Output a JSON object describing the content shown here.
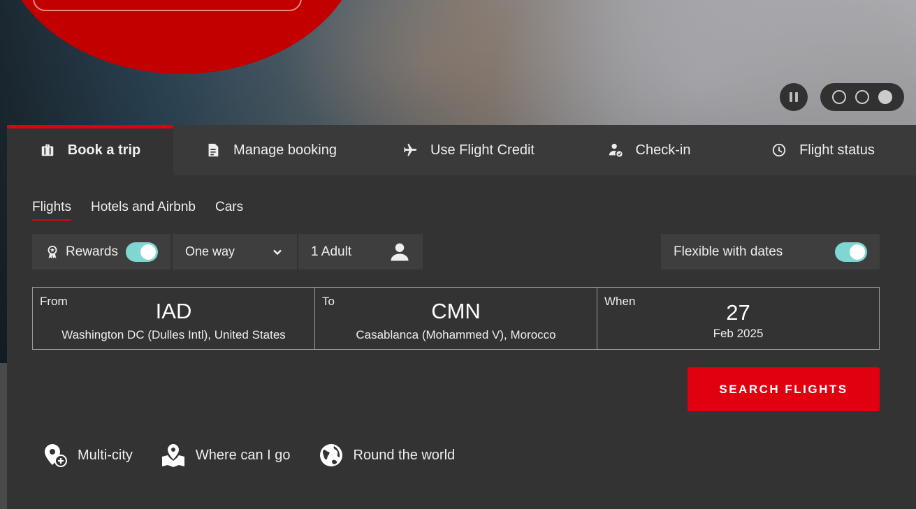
{
  "tabs": [
    {
      "label": "Book a trip",
      "icon": "briefcase-icon"
    },
    {
      "label": "Manage booking",
      "icon": "document-icon"
    },
    {
      "label": "Use Flight Credit",
      "icon": "airplane-icon"
    },
    {
      "label": "Check-in",
      "icon": "person-check-icon"
    },
    {
      "label": "Flight status",
      "icon": "clock-icon"
    }
  ],
  "subtabs": [
    "Flights",
    "Hotels and Airbnb",
    "Cars"
  ],
  "controls": {
    "rewards_label": "Rewards",
    "trip_type": "One way",
    "passengers": "1 Adult",
    "flexible_label": "Flexible with dates"
  },
  "fields": {
    "from": {
      "label": "From",
      "code": "IAD",
      "name": "Washington DC (Dulles Intl), United States"
    },
    "to": {
      "label": "To",
      "code": "CMN",
      "name": "Casablanca (Mohammed V), Morocco"
    },
    "when": {
      "label": "When",
      "day": "27",
      "month": "Feb 2025"
    }
  },
  "search_label": "SEARCH FLIGHTS",
  "links": [
    {
      "label": "Multi-city",
      "icon": "pin-plus-icon"
    },
    {
      "label": "Where can I go",
      "icon": "map-pin-icon"
    },
    {
      "label": "Round the world",
      "icon": "globe-icon"
    }
  ],
  "colors": {
    "accent": "#e0000f",
    "toggle": "#7fd6d3",
    "panel": "#333333"
  }
}
